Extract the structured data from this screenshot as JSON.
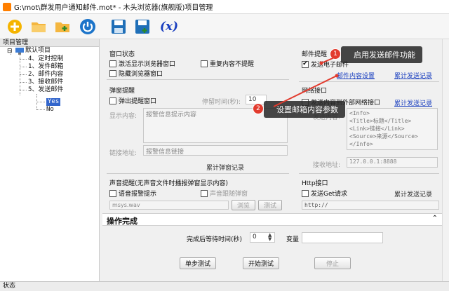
{
  "window": {
    "title": "G:\\mot\\群发用户通知邮件.mot* - 木头浏览器(旗舰版)项目管理"
  },
  "toolbar": {
    "icons": [
      "new-icon",
      "open-folder-icon",
      "add-folder-icon",
      "power-icon",
      "save-icon",
      "save-as-icon",
      "variable-icon"
    ],
    "variable_glyph": "(x)"
  },
  "tree": {
    "header": "项目管理",
    "root": "默认项目",
    "items": [
      "4、定时控制",
      "1、发件邮箱",
      "2、邮件内容",
      "3、接收邮件",
      "5、发送邮件"
    ],
    "children": [
      "Yes",
      "No"
    ]
  },
  "window_state": {
    "title": "窗口状态",
    "activate": "激活显示浏览器窗口",
    "hide": "隐藏浏览器窗口",
    "no_repeat": "重复内容不提醒"
  },
  "popup": {
    "title": "弹窗提醒",
    "checkbox": "弹出提醒窗口",
    "stay_label": "停留时间(秒):",
    "stay_value": "10",
    "content_label": "显示内容:",
    "content_value": "报警信息提示内容",
    "link_label": "链接地址:",
    "link_value": "报警信息链接",
    "records": "累计弹窗记录"
  },
  "sound": {
    "title": "声音提醒(无声音文件时播报弹窗显示内容)",
    "alarm": "语音报警提示",
    "follow": "声音跟随弹窗",
    "file": "msys.wav",
    "browse": "浏览",
    "test": "测试"
  },
  "mail": {
    "title": "邮件提醒",
    "send": "发送电子邮件",
    "send_checked": "✔",
    "settings_link": "邮件内容设置",
    "records_link": "累计发送记录"
  },
  "net": {
    "title": "网络接口",
    "send": "发送内容到外部网络接口",
    "records_link": "累计发送记录",
    "content_label": "发送内容:",
    "content_lines": [
      "<Info>",
      "<Title>标题</Title>",
      "<Link>链接</Link>",
      "<Source>来源</Source>",
      "</Info>"
    ],
    "addr_label": "接收地址:",
    "addr_value": "127.0.0.1:8888"
  },
  "http": {
    "title": "Http接口",
    "send": "发送Get请求",
    "records": "累计发送记录",
    "url": "http://"
  },
  "done": {
    "title": "操作完成",
    "wait_label": "完成后等待时间(秒)",
    "wait_value": "0",
    "var_label": "变量"
  },
  "buttons": {
    "step": "单步测试",
    "start": "开始测试",
    "stop": "停止"
  },
  "callouts": [
    {
      "num": "1",
      "text": "启用发送邮件功能"
    },
    {
      "num": "2",
      "text": "设置邮箱内容参数"
    }
  ],
  "status": "状态",
  "colors": {
    "accent": "#1a3fbf",
    "badge": "#e23b2e",
    "callout_bg": "#282828"
  }
}
